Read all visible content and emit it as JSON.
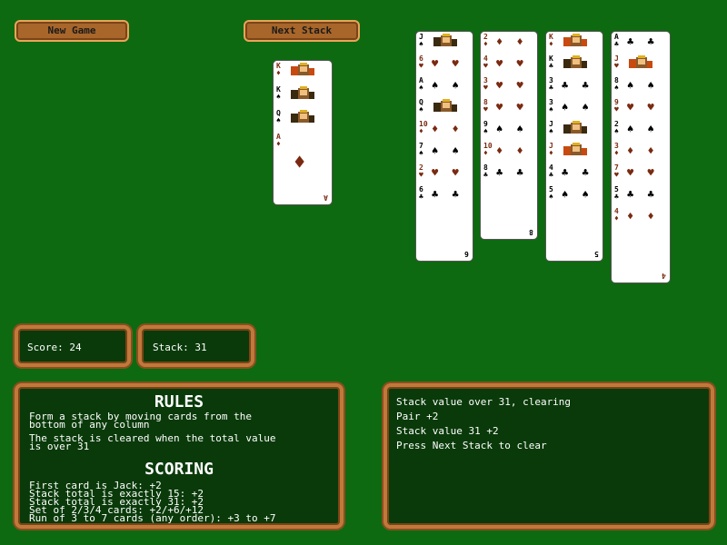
{
  "buttons": {
    "new_game": "New Game",
    "next_stack": "Next Stack"
  },
  "score": {
    "label": "Score: 24"
  },
  "stack": {
    "label": "Stack: 31"
  },
  "rules": {
    "title": "RULES",
    "line1": "Form a stack by moving cards from the",
    "line2": "bottom of any column",
    "line3": "The stack is cleared when the total value",
    "line4": "is over 31",
    "scoring_title": "SCORING",
    "s1": "First card is Jack: +2",
    "s2": "Stack total is exactly 15: +2",
    "s3": "Stack total is exactly 31: +2",
    "s4": "Set of 2/3/4 cards: +2/+6/+12",
    "s5": "Run of 3 to 7 cards (any order): +3 to +7"
  },
  "log": [
    "Stack value over 31, clearing",
    "Pair +2",
    "Stack value 31 +2",
    "Press Next Stack to clear"
  ],
  "stack_pile": [
    {
      "rank": "K",
      "suit": "♦",
      "color": "red",
      "face": true
    },
    {
      "rank": "K",
      "suit": "♠",
      "color": "black",
      "face": true
    },
    {
      "rank": "Q",
      "suit": "♠",
      "color": "black",
      "face": true
    },
    {
      "rank": "A",
      "suit": "♦",
      "color": "red",
      "face": false
    }
  ],
  "columns": [
    [
      {
        "rank": "J",
        "suit": "♠",
        "color": "black",
        "face": true
      },
      {
        "rank": "6",
        "suit": "♥",
        "color": "red"
      },
      {
        "rank": "A",
        "suit": "♠",
        "color": "black"
      },
      {
        "rank": "Q",
        "suit": "♠",
        "color": "black",
        "face": true
      },
      {
        "rank": "10",
        "suit": "♦",
        "color": "red"
      },
      {
        "rank": "7",
        "suit": "♠",
        "color": "black"
      },
      {
        "rank": "2",
        "suit": "♥",
        "color": "red"
      },
      {
        "rank": "6",
        "suit": "♣",
        "color": "black"
      }
    ],
    [
      {
        "rank": "2",
        "suit": "♦",
        "color": "red"
      },
      {
        "rank": "4",
        "suit": "♥",
        "color": "red"
      },
      {
        "rank": "3",
        "suit": "♥",
        "color": "red"
      },
      {
        "rank": "8",
        "suit": "♥",
        "color": "red"
      },
      {
        "rank": "9",
        "suit": "♠",
        "color": "black"
      },
      {
        "rank": "10",
        "suit": "♦",
        "color": "red"
      },
      {
        "rank": "8",
        "suit": "♣",
        "color": "black"
      }
    ],
    [
      {
        "rank": "K",
        "suit": "♦",
        "color": "red",
        "face": true
      },
      {
        "rank": "K",
        "suit": "♣",
        "color": "black",
        "face": true
      },
      {
        "rank": "3",
        "suit": "♣",
        "color": "black"
      },
      {
        "rank": "3",
        "suit": "♠",
        "color": "black"
      },
      {
        "rank": "J",
        "suit": "♠",
        "color": "black",
        "face": true
      },
      {
        "rank": "J",
        "suit": "♦",
        "color": "red",
        "face": true
      },
      {
        "rank": "4",
        "suit": "♣",
        "color": "black"
      },
      {
        "rank": "5",
        "suit": "♠",
        "color": "black"
      }
    ],
    [
      {
        "rank": "A",
        "suit": "♣",
        "color": "black"
      },
      {
        "rank": "J",
        "suit": "♥",
        "color": "red",
        "face": true
      },
      {
        "rank": "8",
        "suit": "♠",
        "color": "black"
      },
      {
        "rank": "9",
        "suit": "♥",
        "color": "red"
      },
      {
        "rank": "2",
        "suit": "♠",
        "color": "black"
      },
      {
        "rank": "3",
        "suit": "♦",
        "color": "red"
      },
      {
        "rank": "7",
        "suit": "♥",
        "color": "red"
      },
      {
        "rank": "5",
        "suit": "♣",
        "color": "black"
      },
      {
        "rank": "4",
        "suit": "♦",
        "color": "red"
      }
    ]
  ]
}
